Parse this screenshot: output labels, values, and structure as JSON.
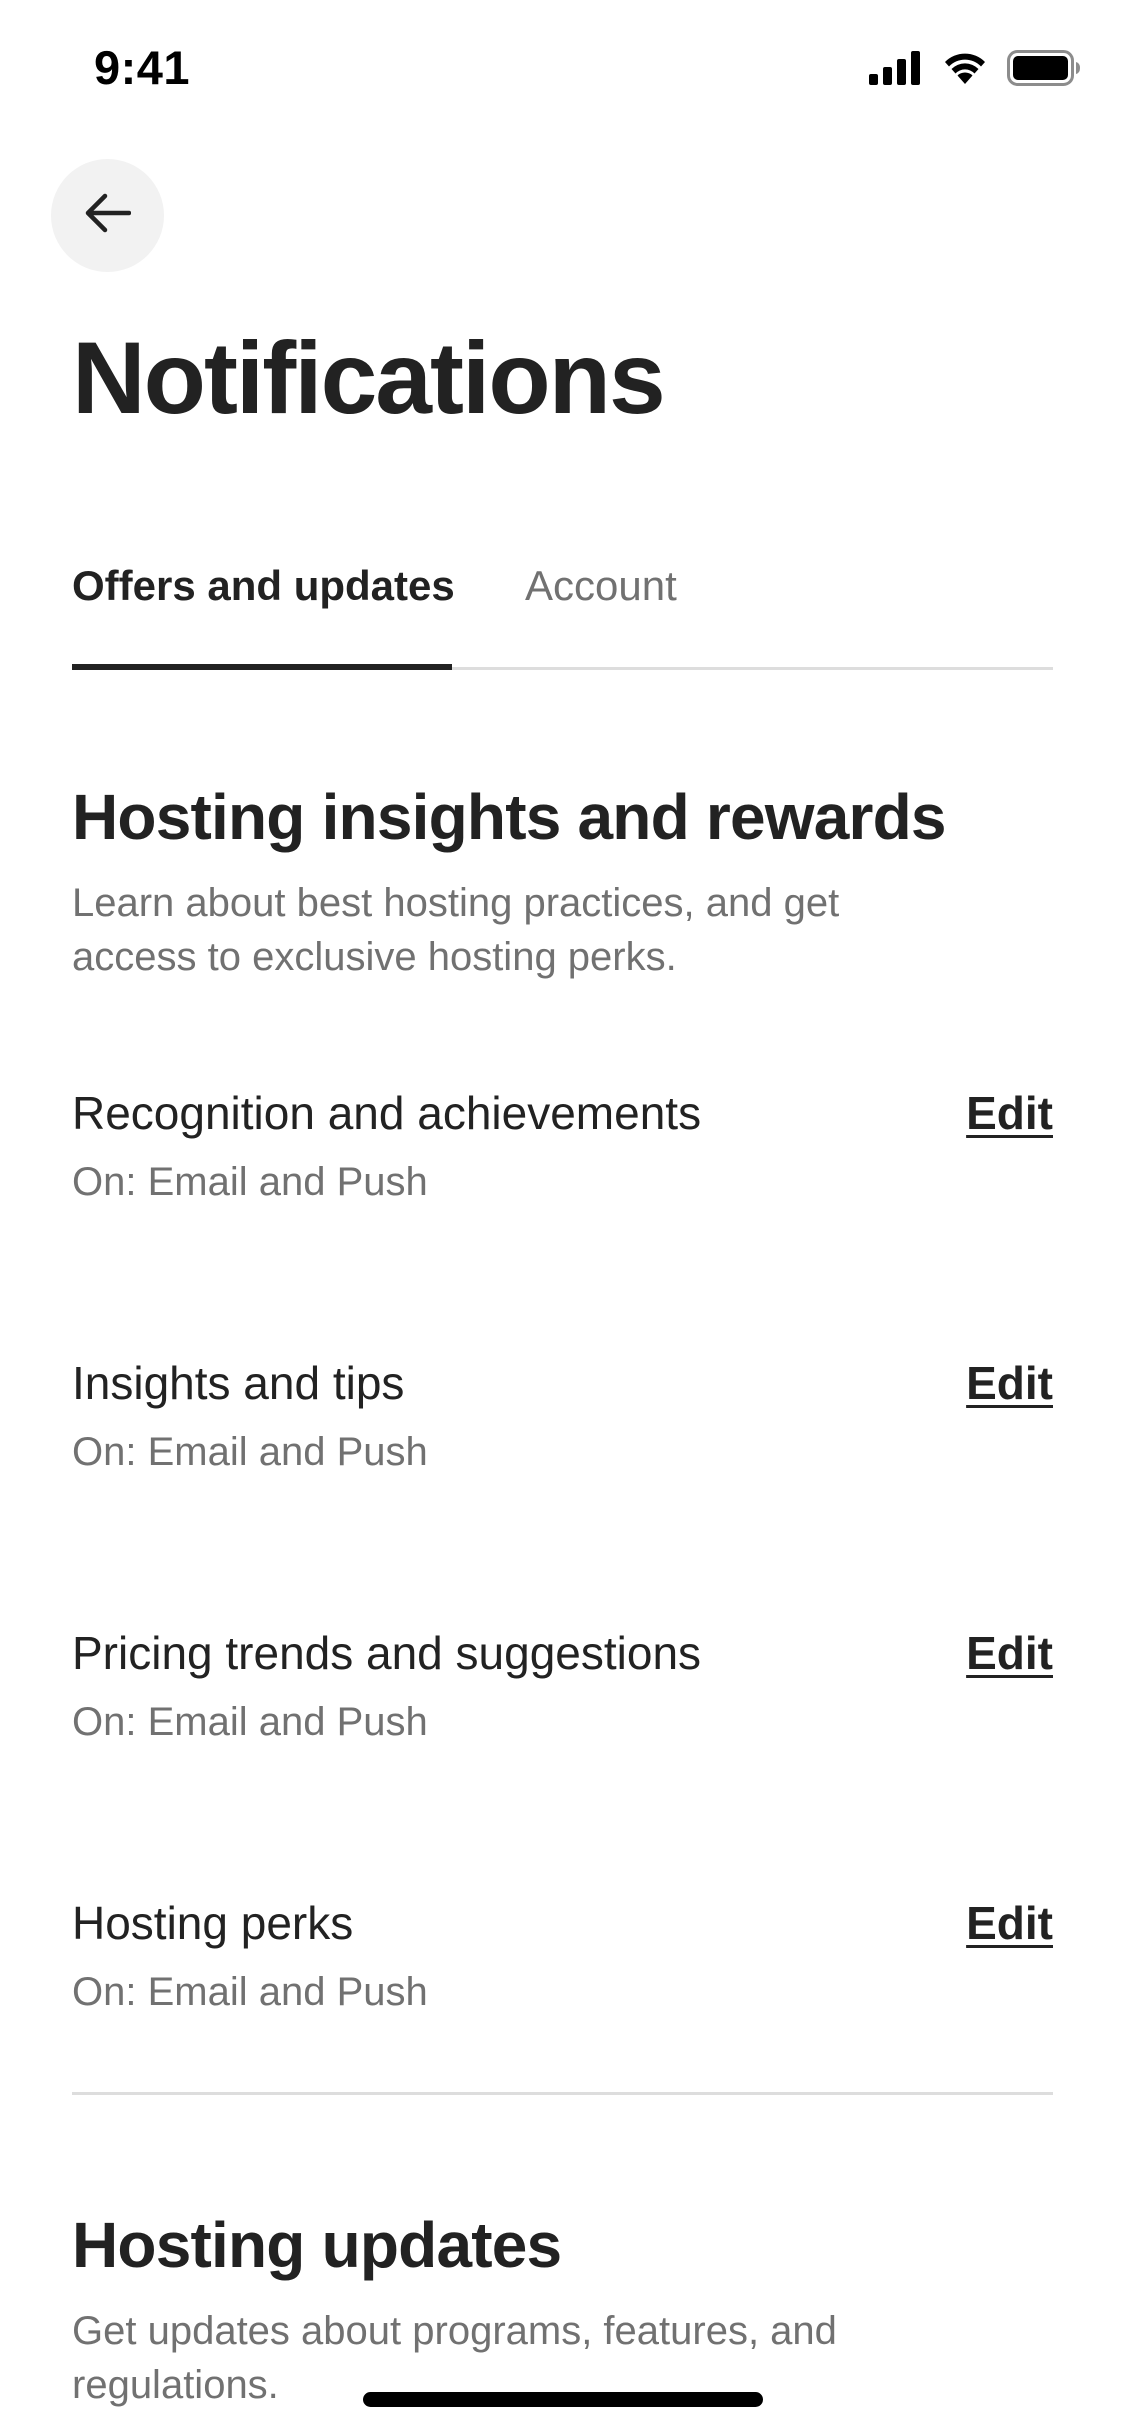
{
  "status_bar": {
    "time": "9:41",
    "icons": [
      "cellular-signal-icon",
      "wifi-icon",
      "battery-icon"
    ]
  },
  "header": {
    "back_icon": "arrow-left-icon",
    "title": "Notifications"
  },
  "tabs": [
    {
      "label": "Offers and updates",
      "active": true
    },
    {
      "label": "Account",
      "active": false
    }
  ],
  "sections": [
    {
      "title": "Hosting insights and rewards",
      "description": "Learn about best hosting practices, and get access to exclusive hosting perks.",
      "items": [
        {
          "name": "Recognition and achievements",
          "status": "On: Email and Push",
          "action": "Edit"
        },
        {
          "name": "Insights and tips",
          "status": "On: Email and Push",
          "action": "Edit"
        },
        {
          "name": "Pricing trends and suggestions",
          "status": "On: Email and Push",
          "action": "Edit"
        },
        {
          "name": "Hosting perks",
          "status": "On: Email and Push",
          "action": "Edit"
        }
      ]
    },
    {
      "title": "Hosting updates",
      "description": "Get updates about programs, features, and regulations."
    }
  ],
  "colors": {
    "primary_text": "#222222",
    "secondary_text": "#717171",
    "divider": "#dddddd",
    "back_button_bg": "#f2f2f2"
  }
}
